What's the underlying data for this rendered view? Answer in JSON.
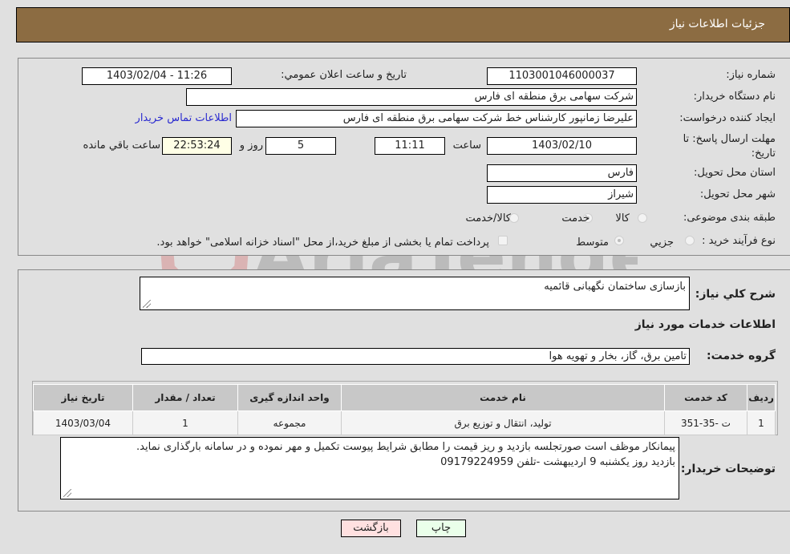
{
  "header": {
    "title": "جزئیات اطلاعات نیاز"
  },
  "details": {
    "need_number_label": "شماره نیاز:",
    "need_number": "1103001046000037",
    "announce_label": "تاریخ و ساعت اعلان عمومي:",
    "announce_value": "1403/02/04 - 11:26",
    "buyer_org_label": "نام دستگاه خریدار:",
    "buyer_org": "شرکت سهامی برق منطقه ای فارس",
    "creator_label": "ایجاد کننده درخواست:",
    "creator": "علیرضا زمانپور کارشناس خط شرکت سهامی برق منطقه ای فارس",
    "contact_link": "اطلاعات تماس خریدار",
    "deadline_label": "مهلت ارسال پاسخ: تا تاریخ:",
    "deadline_date": "1403/02/10",
    "time_label": "ساعت",
    "deadline_time": "11:11",
    "days_value": "5",
    "days_label": "روز و",
    "remaining_time": "22:53:24",
    "remaining_label": "ساعت باقي مانده",
    "province_label": "استان محل تحویل:",
    "province": "فارس",
    "city_label": "شهر محل تحویل:",
    "city": "شیراز",
    "category_label": "طبقه بندی موضوعی:",
    "category_options": [
      "کالا",
      "خدمت",
      "کالا/خدمت"
    ],
    "category_selected": "خدمت",
    "process_label": "نوع فرآیند خرید :",
    "process_options": [
      "جزيي",
      "متوسط"
    ],
    "process_selected": "متوسط",
    "treasury_note": "پرداخت تمام یا بخشی از مبلغ خرید،از محل \"اسناد خزانه اسلامی\" خواهد بود."
  },
  "summary": {
    "description_label": "شرح کلي نياز:",
    "description": "بازسازی ساختمان نگهبانی قائمیه",
    "services_heading": "اطلاعات خدمات مورد نیاز",
    "service_group_label": "گروه خدمت:",
    "service_group": "تامین برق، گاز، بخار و تهویه هوا"
  },
  "table": {
    "headers": [
      "ردیف",
      "کد خدمت",
      "نام خدمت",
      "واحد اندازه گیری",
      "تعداد / مقدار",
      "تاریخ نیاز"
    ],
    "rows": [
      [
        "1",
        "ت -35-351",
        "تولید، انتقال و توزیع برق",
        "مجموعه",
        "1",
        "1403/03/04"
      ]
    ]
  },
  "buyer_notes": {
    "label": "توضیحات خریدار:",
    "line1": "پیمانکار موظف است صورتجلسه بازدید و ریز قیمت را مطابق شرایط پیوست تکمیل و مهر نموده و در سامانه بارگذاری نماید.",
    "line2": "بازدید روز یکشنبه 9 اردیبهشت -تلفن 09179224959"
  },
  "buttons": {
    "print": "چاپ",
    "back": "بازگشت"
  },
  "colors": {
    "header_bg": "#8c6c42",
    "print_bg": "#eaffea",
    "back_bg": "#ffe0e0",
    "link": "#2a2ad0"
  },
  "watermark": "AriaTender.neT"
}
